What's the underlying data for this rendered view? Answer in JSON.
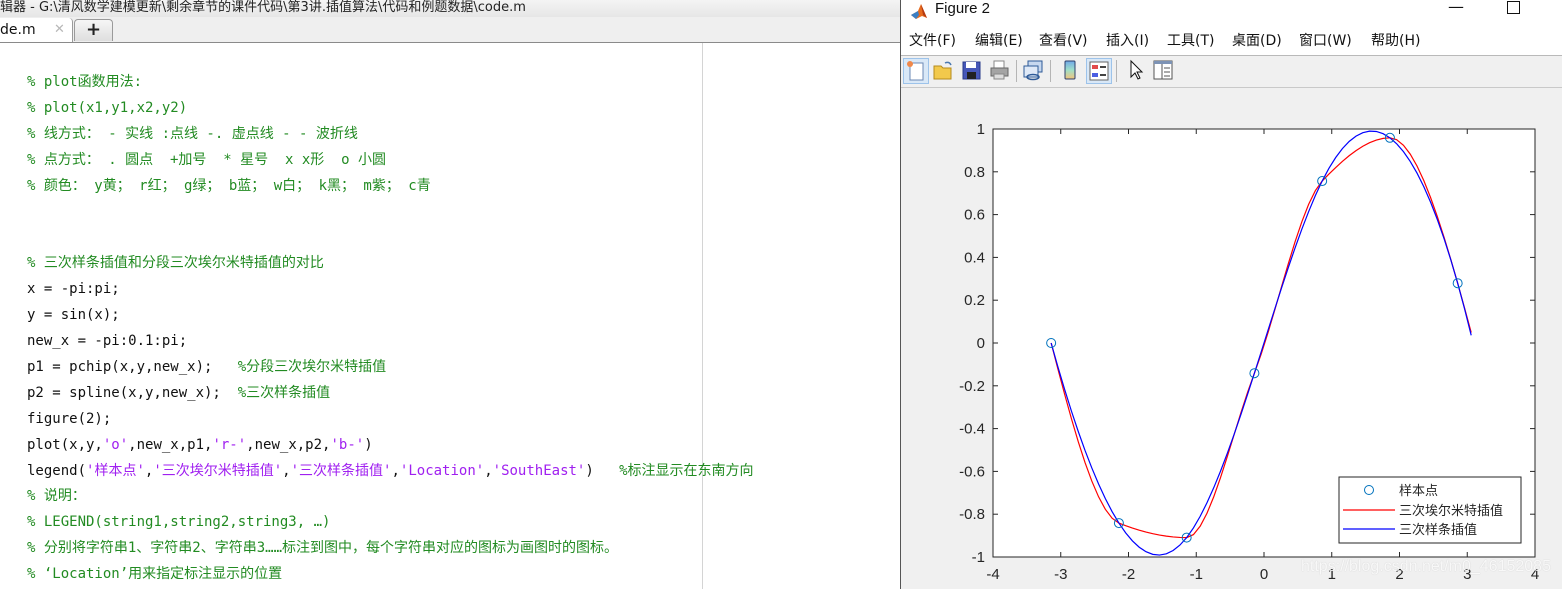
{
  "editor": {
    "window_title": "辑器 - G:\\清风数学建模更新\\剩余章节的课件代码\\第3讲.插值算法\\代码和例题数据\\code.m",
    "tab_label": "de.m",
    "tab_close": "✕",
    "new_tab": "+",
    "lines": [
      {
        "segs": [
          {
            "t": "% plot函数用法:",
            "c": "cm"
          }
        ]
      },
      {
        "segs": [
          {
            "t": "% plot(x1,y1,x2,y2)",
            "c": "cm"
          }
        ]
      },
      {
        "segs": [
          {
            "t": "% 线方式： - 实线 :点线 -. 虚点线 - - 波折线",
            "c": "cm"
          }
        ]
      },
      {
        "segs": [
          {
            "t": "% 点方式： . 圆点  +加号  * 星号  x x形  o 小圆",
            "c": "cm"
          }
        ]
      },
      {
        "segs": [
          {
            "t": "% 颜色： y黄； r红； g绿； b蓝； w白； k黑； m紫； c青",
            "c": "cm"
          }
        ]
      },
      {
        "segs": []
      },
      {
        "segs": []
      },
      {
        "segs": [
          {
            "t": "% 三次样条插值和分段三次埃尔米特插值的对比",
            "c": "cm"
          }
        ]
      },
      {
        "segs": [
          {
            "t": "x = -pi:pi;",
            "c": ""
          }
        ]
      },
      {
        "segs": [
          {
            "t": "y = sin(x);",
            "c": ""
          }
        ]
      },
      {
        "segs": [
          {
            "t": "new_x = -pi:0.1:pi;",
            "c": ""
          }
        ]
      },
      {
        "segs": [
          {
            "t": "p1 = pchip(x,y,new_x);   ",
            "c": ""
          },
          {
            "t": "%分段三次埃尔米特插值",
            "c": "cm"
          }
        ]
      },
      {
        "segs": [
          {
            "t": "p2 = spline(x,y,new_x);  ",
            "c": ""
          },
          {
            "t": "%三次样条插值",
            "c": "cm"
          }
        ]
      },
      {
        "segs": [
          {
            "t": "figure(2);",
            "c": ""
          }
        ]
      },
      {
        "segs": [
          {
            "t": "plot(x,y,",
            "c": ""
          },
          {
            "t": "'o'",
            "c": "st"
          },
          {
            "t": ",new_x,p1,",
            "c": ""
          },
          {
            "t": "'r-'",
            "c": "st"
          },
          {
            "t": ",new_x,p2,",
            "c": ""
          },
          {
            "t": "'b-'",
            "c": "st"
          },
          {
            "t": ")",
            "c": ""
          }
        ]
      },
      {
        "segs": [
          {
            "t": "legend(",
            "c": ""
          },
          {
            "t": "'样本点'",
            "c": "st"
          },
          {
            "t": ",",
            "c": ""
          },
          {
            "t": "'三次埃尔米特插值'",
            "c": "st"
          },
          {
            "t": ",",
            "c": ""
          },
          {
            "t": "'三次样条插值'",
            "c": "st"
          },
          {
            "t": ",",
            "c": ""
          },
          {
            "t": "'Location'",
            "c": "st"
          },
          {
            "t": ",",
            "c": ""
          },
          {
            "t": "'SouthEast'",
            "c": "st"
          },
          {
            "t": ")   ",
            "c": ""
          },
          {
            "t": "%标注显示在东南方向",
            "c": "cm"
          }
        ]
      },
      {
        "segs": [
          {
            "t": "% 说明：",
            "c": "cm"
          }
        ]
      },
      {
        "segs": [
          {
            "t": "% LEGEND(string1,string2,string3, …)",
            "c": "cm"
          }
        ]
      },
      {
        "segs": [
          {
            "t": "% 分别将字符串1、字符串2、字符串3……标注到图中，每个字符串对应的图标为画图时的图标。",
            "c": "cm"
          }
        ]
      },
      {
        "segs": [
          {
            "t": "% ‘Location’用来指定标注显示的位置",
            "c": "cm"
          }
        ]
      }
    ]
  },
  "figure": {
    "title": "Figure 2",
    "minimize": "—",
    "menu": [
      "文件(F)",
      "编辑(E)",
      "查看(V)",
      "插入(I)",
      "工具(T)",
      "桌面(D)",
      "窗口(W)",
      "帮助(H)"
    ],
    "toolbar": [
      {
        "icon": "new-figure-icon",
        "active": true
      },
      {
        "icon": "open-file-icon",
        "active": false
      },
      {
        "icon": "save-icon",
        "active": false
      },
      {
        "icon": "print-icon",
        "active": false
      },
      {
        "icon": "link-plot-icon",
        "active": false
      },
      {
        "icon": "colorbar-icon",
        "active": false
      },
      {
        "icon": "legend-icon",
        "active": true
      },
      {
        "icon": "pointer-icon",
        "active": false
      },
      {
        "icon": "property-editor-icon",
        "active": false
      }
    ],
    "watermark": "https://blog.csdn.net/m0_46152085"
  },
  "chart_data": {
    "type": "line",
    "title": "",
    "xlabel": "",
    "ylabel": "",
    "xlim": [
      -4,
      4
    ],
    "ylim": [
      -1,
      1
    ],
    "xticks": [
      -4,
      -3,
      -2,
      -1,
      0,
      1,
      2,
      3,
      4
    ],
    "yticks": [
      -1,
      -0.8,
      -0.6,
      -0.4,
      -0.2,
      0,
      0.2,
      0.4,
      0.6,
      0.8,
      1
    ],
    "ytick_labels": [
      "-1",
      "-0.8",
      "-0.6",
      "-0.4",
      "-0.2",
      "0",
      "0.2",
      "0.4",
      "0.6",
      "0.8",
      "1"
    ],
    "grid": false,
    "legend_position": "bottom-right",
    "samples": {
      "name": "样本点",
      "color": "#0072bd",
      "x": [
        -3.1416,
        -2.1416,
        -1.1416,
        -0.1416,
        0.8584,
        1.8584,
        2.8584
      ],
      "y": [
        0.0,
        -0.8415,
        -0.9093,
        -0.1411,
        0.7568,
        0.9589,
        0.2794
      ]
    },
    "series": [
      {
        "name": "三次埃尔米特插值",
        "color": "#ff0000",
        "method": "pchip",
        "x_start": -3.1416,
        "x_step": 0.1,
        "x_end": 3.0584
      },
      {
        "name": "三次样条插值",
        "color": "#0000ff",
        "method": "spline",
        "x_start": -3.1416,
        "x_step": 0.1,
        "x_end": 3.0584
      }
    ]
  }
}
